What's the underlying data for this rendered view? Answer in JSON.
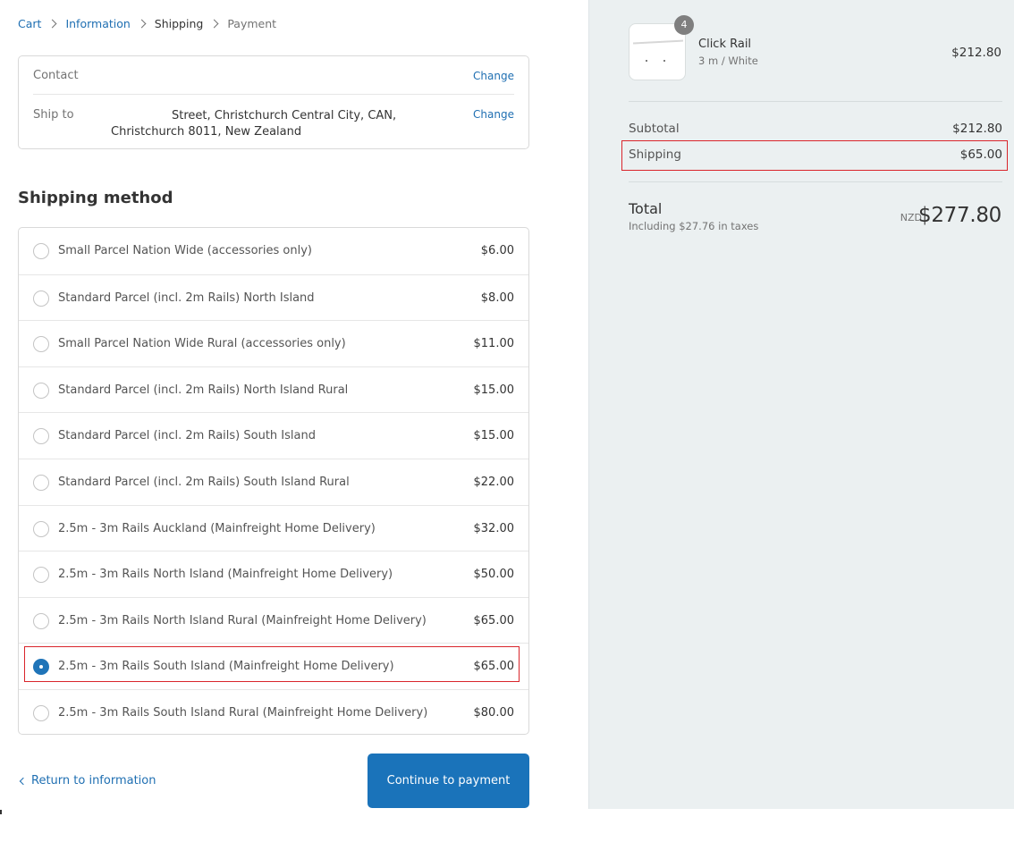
{
  "breadcrumb": {
    "cart": "Cart",
    "information": "Information",
    "shipping": "Shipping",
    "payment": "Payment"
  },
  "review": {
    "contact_label": "Contact",
    "contact_change": "Change",
    "ship_to_label": "Ship to",
    "ship_to_value": "Street, Christchurch Central City, CAN, Christchurch 8011, New Zealand",
    "ship_to_change": "Change"
  },
  "shipping_method": {
    "title": "Shipping method",
    "selected_index": 9,
    "options": [
      {
        "name": "Small Parcel Nation Wide (accessories only)",
        "price": "$6.00"
      },
      {
        "name": "Standard Parcel (incl. 2m Rails) North Island",
        "price": "$8.00"
      },
      {
        "name": "Small Parcel Nation Wide Rural (accessories only)",
        "price": "$11.00"
      },
      {
        "name": "Standard Parcel (incl. 2m Rails) North Island Rural",
        "price": "$15.00"
      },
      {
        "name": "Standard Parcel (incl. 2m Rails) South Island",
        "price": "$15.00"
      },
      {
        "name": "Standard Parcel (incl. 2m Rails) South Island Rural",
        "price": "$22.00"
      },
      {
        "name": "2.5m - 3m Rails Auckland (Mainfreight Home Delivery)",
        "price": "$32.00"
      },
      {
        "name": "2.5m - 3m Rails North Island (Mainfreight Home Delivery)",
        "price": "$50.00"
      },
      {
        "name": "2.5m - 3m Rails North Island Rural (Mainfreight Home Delivery)",
        "price": "$65.00"
      },
      {
        "name": "2.5m - 3m Rails South Island (Mainfreight Home Delivery)",
        "price": "$65.00"
      },
      {
        "name": "2.5m - 3m Rails South Island Rural (Mainfreight Home Delivery)",
        "price": "$80.00"
      }
    ]
  },
  "actions": {
    "return_label": "Return to information",
    "continue_label": "Continue to payment"
  },
  "summary": {
    "product": {
      "name": "Click Rail",
      "variant": "3 m / White",
      "quantity": "4",
      "price": "$212.80"
    },
    "subtotal_label": "Subtotal",
    "subtotal_value": "$212.80",
    "shipping_label": "Shipping",
    "shipping_value": "$65.00",
    "total_label": "Total",
    "tax_note": "Including $27.76 in taxes",
    "currency": "NZD",
    "total_value": "$277.80"
  },
  "colors": {
    "link": "#1f6fb2",
    "primary_button": "#1a73ba",
    "selected_radio": "#1f74b8",
    "annotation_highlight": "#d9252b",
    "summary_background": "#ebf0f1"
  }
}
